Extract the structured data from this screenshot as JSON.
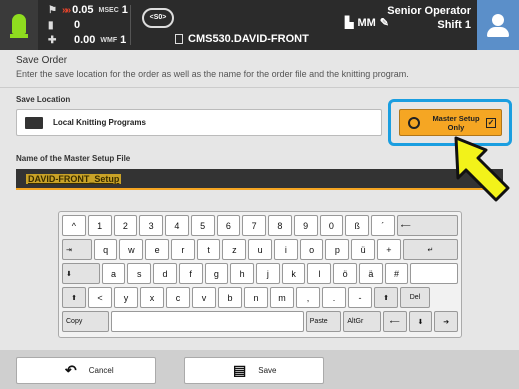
{
  "header": {
    "stats": [
      {
        "icon": "shirt-icon",
        "value": "0.05",
        "unit": "MSEC",
        "count": "1"
      },
      {
        "icon": "bars-icon",
        "value": "0",
        "unit": "",
        "count": ""
      },
      {
        "icon": "spindle-icon",
        "value": "0.00",
        "unit": "WMF",
        "count": "1"
      }
    ],
    "machine_badge": "<S0>",
    "machine_name": "CMS530.DAVID-FRONT",
    "unit_label": "MM",
    "operator": "Senior Operator",
    "shift": "Shift 1",
    "status_color": "#8fdc1f"
  },
  "page": {
    "title": "Save Order",
    "description": "Enter the save location for the order as well as the name for the order file and the knitting program.",
    "save_location_label": "Save Location",
    "local_button": "Local Knitting Programs",
    "master_button_line1": "Master Setup",
    "master_button_line2": "Only",
    "master_checked": "✓",
    "file_label": "Name of the Master Setup File",
    "file_value": "DAVID-FRONT_Setup"
  },
  "keyboard": {
    "row1": [
      "^",
      "1",
      "2",
      "3",
      "4",
      "5",
      "6",
      "7",
      "8",
      "9",
      "0",
      "ß",
      "´",
      "⟵"
    ],
    "row2": [
      "⇥",
      "q",
      "w",
      "e",
      "r",
      "t",
      "z",
      "u",
      "i",
      "o",
      "p",
      "ü",
      "+",
      "↵"
    ],
    "row3": [
      "⬇",
      "a",
      "s",
      "d",
      "f",
      "g",
      "h",
      "j",
      "k",
      "l",
      "ö",
      "ä",
      "#"
    ],
    "row4": [
      "⬆",
      "<",
      "y",
      "x",
      "c",
      "v",
      "b",
      "n",
      "m",
      ",",
      ".",
      "-",
      "⬆",
      "Del"
    ],
    "row5": [
      "Copy",
      "",
      "Paste",
      "AltGr",
      "⟵",
      "⬇",
      "➔"
    ]
  },
  "footer": {
    "cancel": "Cancel",
    "save": "Save"
  },
  "colors": {
    "accent": "#f5a623",
    "highlight_frame": "#1a9ee0",
    "header_bg": "#2b2b2b",
    "user_button": "#5b8fc9"
  }
}
